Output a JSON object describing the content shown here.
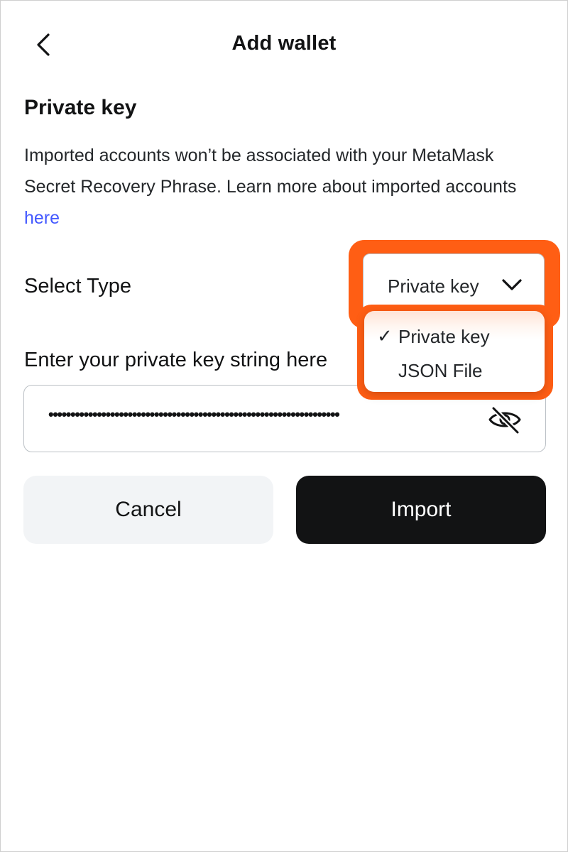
{
  "header": {
    "title": "Add wallet",
    "back_icon": "chevron-left-icon"
  },
  "section": {
    "title": "Private key",
    "description": "Imported accounts won’t be associated with your MetaMask Secret Recovery Phrase. Learn more about imported accounts ",
    "link_text": "here",
    "link_color": "#4459ff"
  },
  "select": {
    "label": "Select Type",
    "selected_value": "Private key",
    "chevron_icon": "chevron-down-icon",
    "highlight_color": "#ff5e14",
    "options": [
      {
        "label": "Private key",
        "selected": true,
        "check": "✓"
      },
      {
        "label": "JSON File",
        "selected": false,
        "check": ""
      }
    ]
  },
  "input": {
    "label": "Enter your private key string here",
    "masked_value": "••••••••••••••••••••••••••••••••••••••••••••••••••••••••••••••••••",
    "ellipsis": "...",
    "eye_icon": "eye-slash-icon"
  },
  "buttons": {
    "cancel_label": "Cancel",
    "import_label": "Import"
  }
}
